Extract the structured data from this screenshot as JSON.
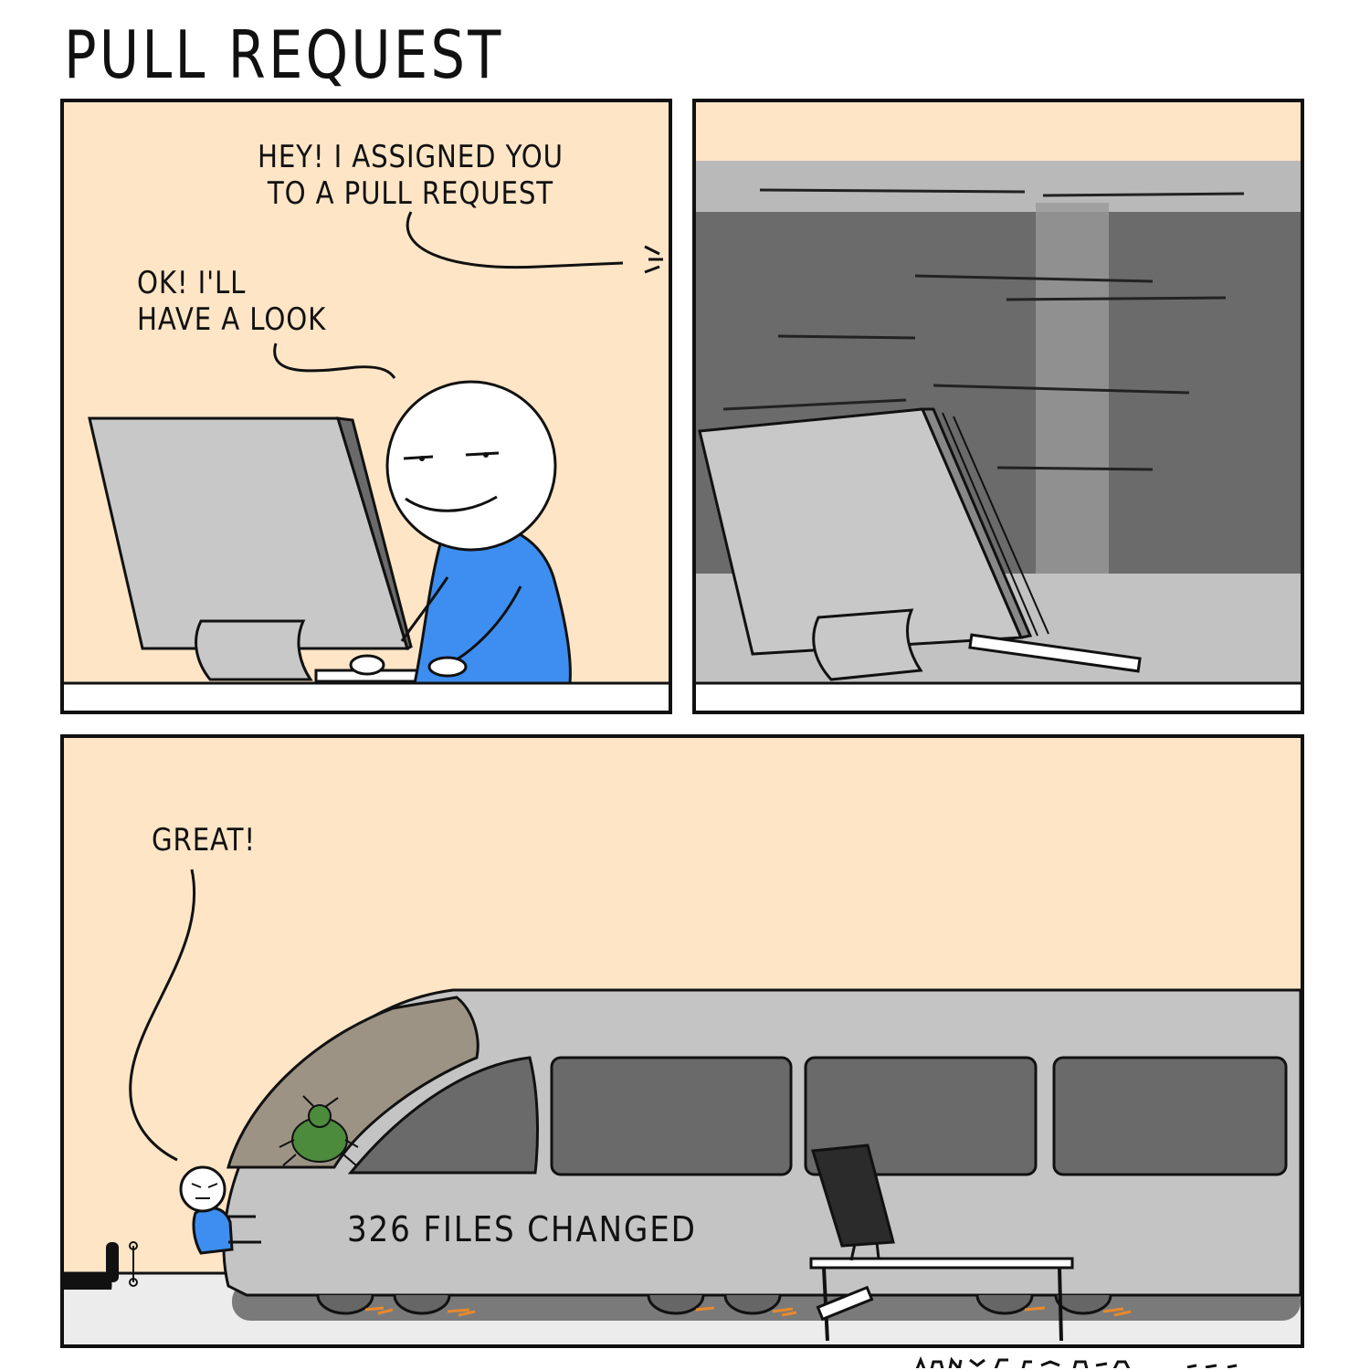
{
  "comic": {
    "title": "PULL REQUEST",
    "panel1": {
      "speech_offscreen": "HEY! I ASSIGNED YOU\nTO A PULL REQUEST",
      "speech_character": "OK! I'LL\nHAVE A LOOK"
    },
    "panel3": {
      "speech_character": "GREAT!",
      "train_label": "326 FILES CHANGED"
    }
  },
  "colors": {
    "background": "#fde5c6",
    "shirt": "#3d8ef0",
    "monitor": "#c8c8c8",
    "train": "#c4c4c4",
    "bug": "#4c8a3c"
  }
}
